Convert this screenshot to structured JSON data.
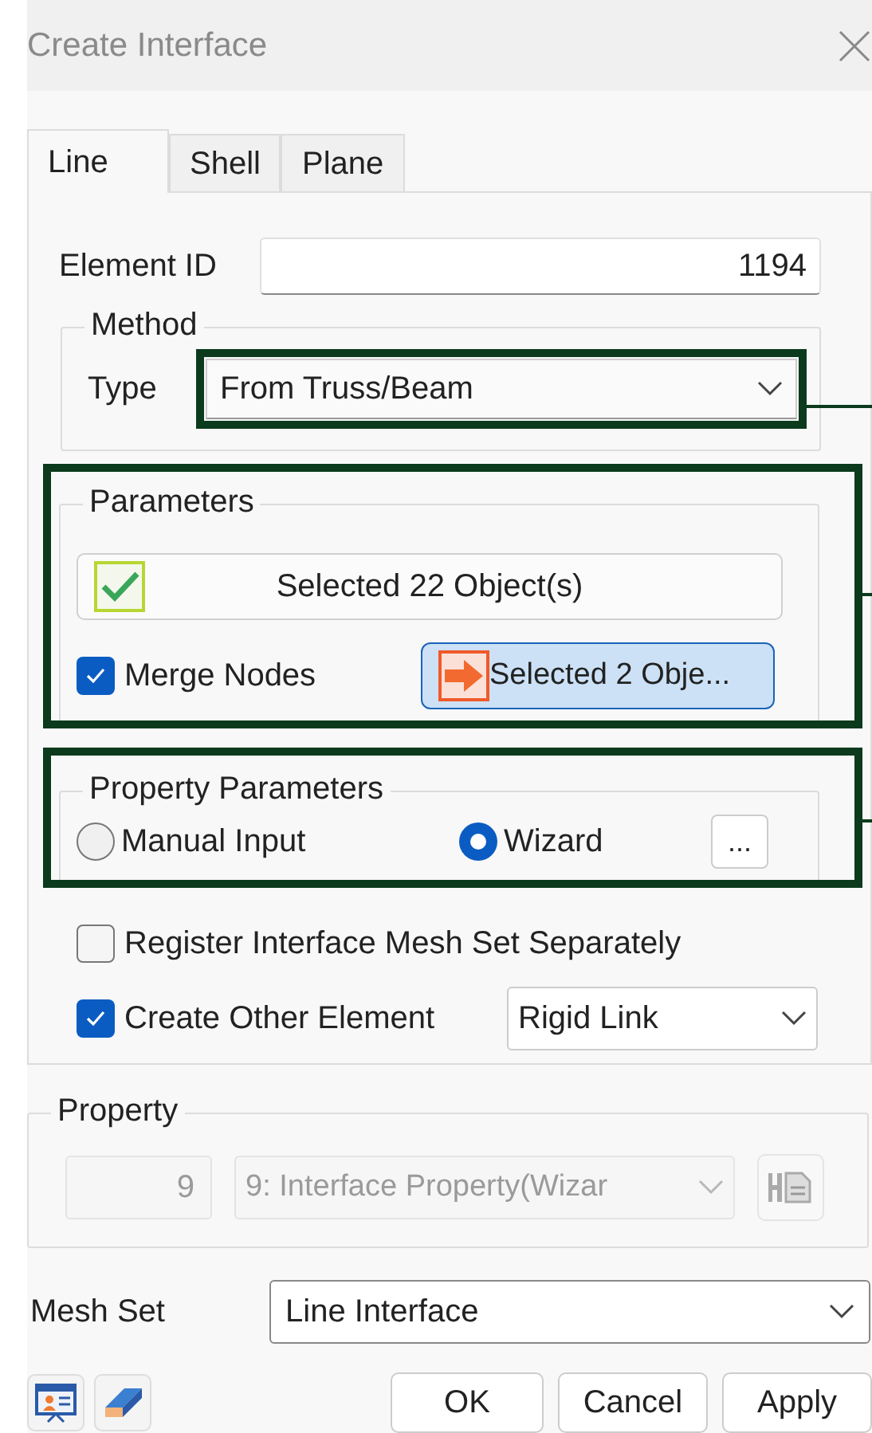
{
  "window": {
    "title": "Create Interface"
  },
  "tabs": [
    {
      "label": "Line",
      "selected": true
    },
    {
      "label": "Shell",
      "selected": false
    },
    {
      "label": "Plane",
      "selected": false
    }
  ],
  "element_id": {
    "label": "Element ID",
    "value": "1194"
  },
  "method": {
    "title": "Method",
    "type_label": "Type",
    "type_value": "From Truss/Beam"
  },
  "parameters": {
    "title": "Parameters",
    "select_button": "Selected 22 Object(s)",
    "merge_nodes": {
      "label": "Merge Nodes",
      "checked": true
    },
    "node_button": "Selected 2 Obje..."
  },
  "property_parameters": {
    "title": "Property Parameters",
    "options": [
      {
        "label": "Manual Input",
        "selected": false
      },
      {
        "label": "Wizard",
        "selected": true
      }
    ],
    "more_button": "..."
  },
  "register_mesh_set": {
    "label": "Register Interface Mesh Set Separately",
    "checked": false
  },
  "create_other": {
    "label": "Create Other Element",
    "checked": true,
    "value": "Rigid Link"
  },
  "property": {
    "title": "Property",
    "number": "9",
    "value": "9: Interface Property(Wizar",
    "disabled": true
  },
  "mesh_set": {
    "label": "Mesh Set",
    "value": "Line Interface"
  },
  "buttons": [
    "OK",
    "Cancel",
    "Apply"
  ]
}
